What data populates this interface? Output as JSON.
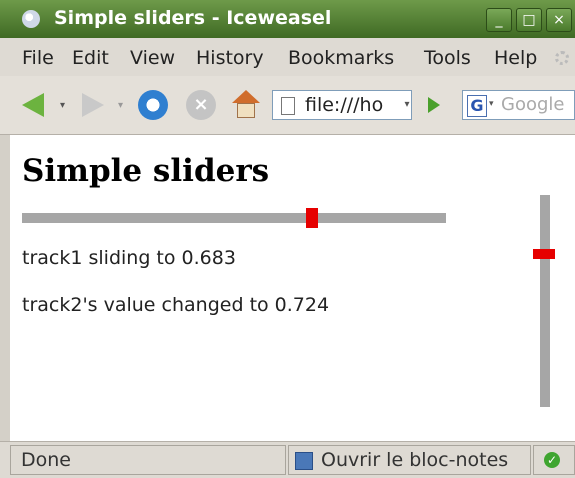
{
  "window": {
    "title": "Simple sliders - Iceweasel",
    "controls": {
      "minimize": "_",
      "maximize": "□",
      "close": "×"
    }
  },
  "menu": {
    "items": [
      "File",
      "Edit",
      "View",
      "History",
      "Bookmarks",
      "Tools",
      "Help"
    ]
  },
  "toolbar": {
    "url": "file:///ho",
    "search_placeholder": "Google",
    "search_engine_letter": "G",
    "icons": [
      "back-arrow-icon",
      "forward-arrow-icon",
      "reload-icon",
      "stop-icon",
      "home-icon",
      "page-icon",
      "go-icon",
      "google-icon"
    ]
  },
  "page": {
    "title": "Simple sliders",
    "track1": {
      "value": 0.683
    },
    "track2": {
      "value": 0.724
    },
    "status1": "track1 sliding to 0.683",
    "status2": "track2's value changed to 0.724"
  },
  "statusbar": {
    "status": "Done",
    "notes": "Ouvrir le bloc-notes"
  },
  "colors": {
    "titlebar": "#4f7e32",
    "slider_track": "#a6a6a6",
    "slider_thumb": "#e60000"
  }
}
